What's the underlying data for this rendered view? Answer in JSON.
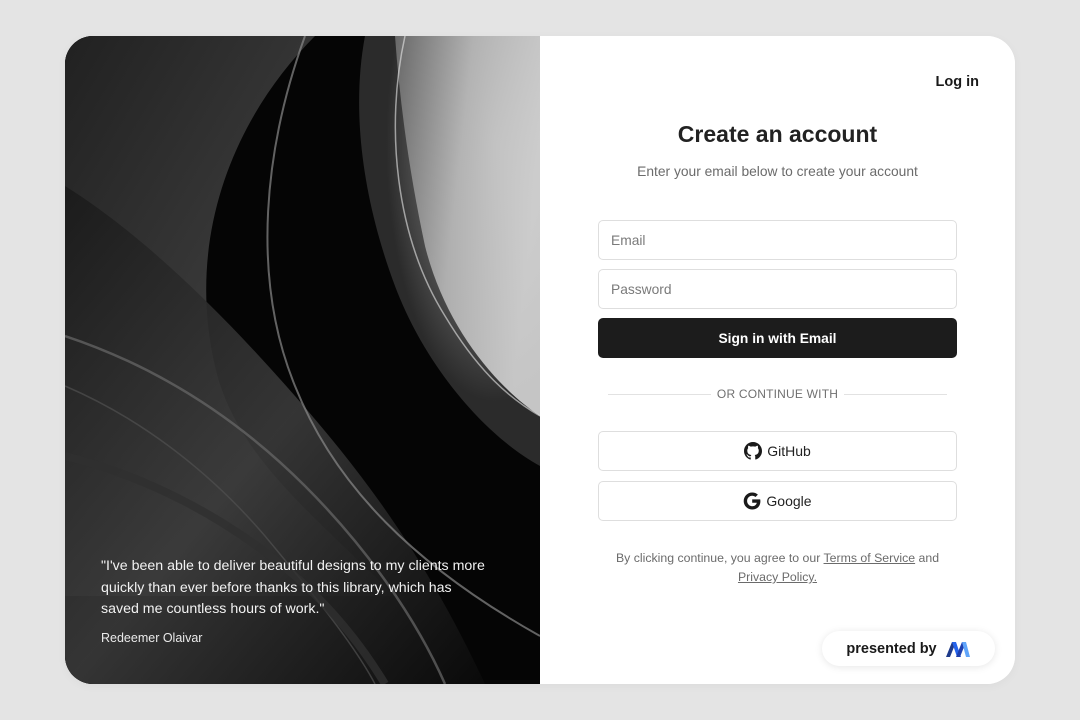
{
  "auth_panel": {
    "login_link": "Log in",
    "title": "Create an account",
    "subtitle": "Enter your email below to create your account",
    "email_placeholder": "Email",
    "password_placeholder": "Password",
    "email_value": "",
    "password_value": "",
    "submit_label": "Sign in with Email",
    "divider_label": "OR CONTINUE WITH",
    "github_label": "GitHub",
    "google_label": "Google",
    "terms_prefix": "By clicking continue, you agree to our ",
    "terms_link": "Terms of Service",
    "terms_middle": " and",
    "privacy_link": "Privacy Policy."
  },
  "testimonial": {
    "quote": "\"I've been able to deliver beautiful designs to my clients more quickly than ever before thanks to this library, which has saved me countless hours of work.\"",
    "author": "Redeemer Olaivar"
  },
  "badge": {
    "label": "presented by"
  },
  "icons": {
    "github": "github-icon",
    "google": "google-icon",
    "brand": "brand-logo-icon"
  },
  "colors": {
    "primary_button": "#1c1c1c",
    "panel_background": "#000000",
    "brand_blue": "#3b82f6"
  }
}
